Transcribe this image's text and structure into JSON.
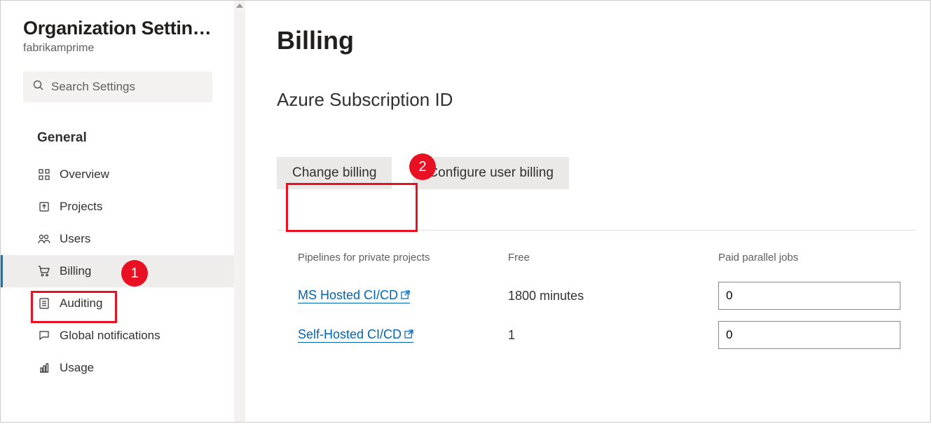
{
  "sidebar": {
    "title": "Organization Settin…",
    "subtitle": "fabrikamprime",
    "search_placeholder": "Search Settings",
    "section_label": "General",
    "items": [
      {
        "label": "Overview",
        "icon": "overview"
      },
      {
        "label": "Projects",
        "icon": "projects"
      },
      {
        "label": "Users",
        "icon": "users"
      },
      {
        "label": "Billing",
        "icon": "billing"
      },
      {
        "label": "Auditing",
        "icon": "auditing"
      },
      {
        "label": "Global notifications",
        "icon": "notifications"
      },
      {
        "label": "Usage",
        "icon": "usage"
      }
    ]
  },
  "main": {
    "page_title": "Billing",
    "sub_heading": "Azure Subscription ID",
    "buttons": {
      "change_billing": "Change billing",
      "configure_user_billing": "Configure user billing"
    },
    "table": {
      "headers": {
        "col1": "Pipelines for private projects",
        "col2": "Free",
        "col3": "Paid parallel jobs"
      },
      "rows": [
        {
          "name": "MS Hosted CI/CD",
          "free": "1800 minutes",
          "paid": "0"
        },
        {
          "name": "Self-Hosted CI/CD",
          "free": "1",
          "paid": "0"
        }
      ]
    }
  },
  "callouts": {
    "one": "1",
    "two": "2"
  }
}
